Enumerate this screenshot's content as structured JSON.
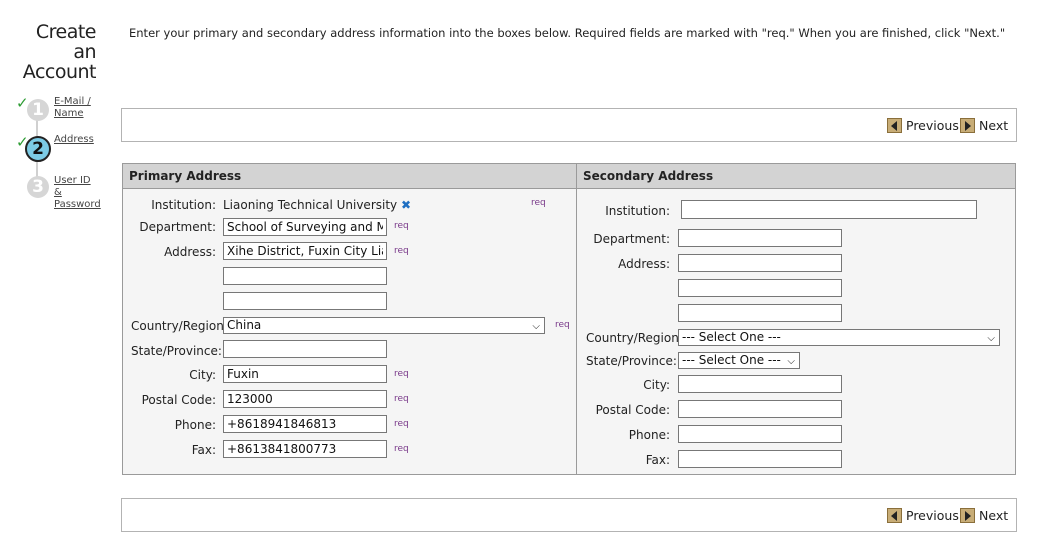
{
  "page": {
    "title_line1": "Create an",
    "title_line2": "Account",
    "instructions": "Enter your primary and secondary address information into the boxes below. Required fields are marked with \"req.\" When you are finished, click \"Next.\""
  },
  "steps": [
    {
      "number": "1",
      "label_line1": "E-Mail /",
      "label_line2": "Name",
      "status": "complete"
    },
    {
      "number": "2",
      "label_line1": "Address",
      "status": "current"
    },
    {
      "number": "3",
      "label_line1": "User ID",
      "label_line2": "&",
      "label_line3": "Password",
      "status": "pending"
    }
  ],
  "nav": {
    "previous_label": "Previous",
    "next_label": "Next"
  },
  "primary": {
    "heading": "Primary Address",
    "req_label": "req",
    "institution_label": "Institution:",
    "institution_value": "Liaoning Technical University",
    "remove_glyph": "✖",
    "department_label": "Department:",
    "department_value": "School of Surveying and Map",
    "address_label": "Address:",
    "address_line1": "Xihe District, Fuxin City Liao",
    "address_line2": "",
    "address_line3": "",
    "country_label": "Country/Region",
    "country_value": "China",
    "state_label": "State/Province:",
    "state_value": "",
    "city_label": "City:",
    "city_value": "Fuxin",
    "postal_label": "Postal Code:",
    "postal_value": "123000",
    "phone_label": "Phone:",
    "phone_value": "+8618941846813",
    "fax_label": "Fax:",
    "fax_value": "+8613841800773"
  },
  "secondary": {
    "heading": "Secondary Address",
    "institution_label": "Institution:",
    "institution_value": "",
    "department_label": "Department:",
    "address_label": "Address:",
    "country_label": "Country/Region",
    "country_value": "--- Select One ---",
    "state_label": "State/Province:",
    "state_value": "--- Select One ---",
    "city_label": "City:",
    "postal_label": "Postal Code:",
    "phone_label": "Phone:",
    "fax_label": "Fax:"
  }
}
